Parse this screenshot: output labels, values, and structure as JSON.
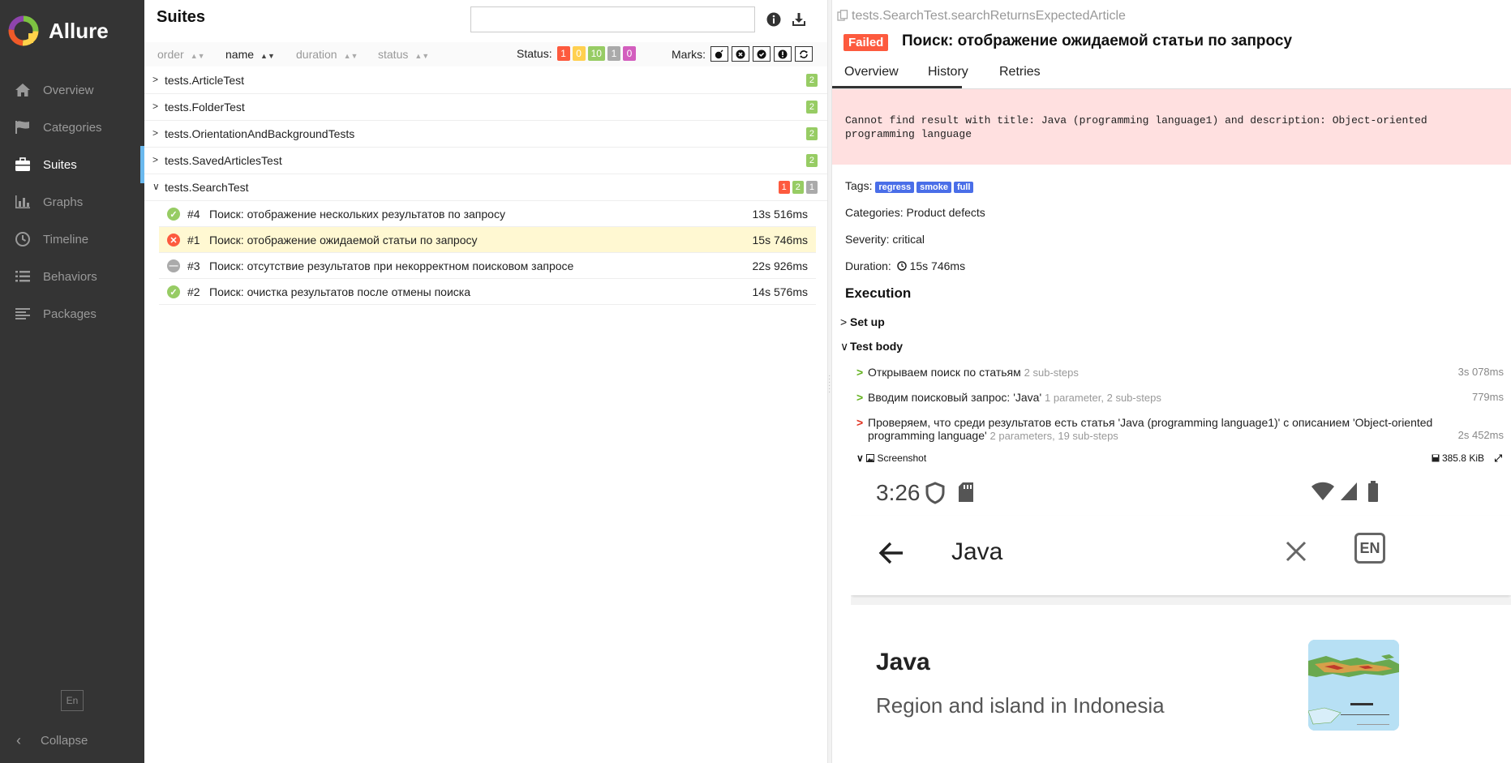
{
  "brand": {
    "name": "Allure"
  },
  "sidebar": {
    "items": [
      {
        "label": "Overview",
        "icon": "home-icon"
      },
      {
        "label": "Categories",
        "icon": "flag-icon"
      },
      {
        "label": "Suites",
        "icon": "briefcase-icon",
        "active": true
      },
      {
        "label": "Graphs",
        "icon": "bar-chart-icon"
      },
      {
        "label": "Timeline",
        "icon": "clock-icon"
      },
      {
        "label": "Behaviors",
        "icon": "list-icon"
      },
      {
        "label": "Packages",
        "icon": "align-left-icon"
      }
    ],
    "lang": "En",
    "collapse": "Collapse"
  },
  "suites": {
    "title": "Suites",
    "search_value": "",
    "sort": {
      "order": "order",
      "name": "name",
      "duration": "duration",
      "status": "status"
    },
    "status_label": "Status:",
    "status_counts": {
      "failed": "1",
      "broken": "0",
      "passed": "10",
      "skipped": "1",
      "unknown": "0"
    },
    "marks_label": "Marks:",
    "groups": [
      {
        "name": "tests.ArticleTest",
        "passed": "2"
      },
      {
        "name": "tests.FolderTest",
        "passed": "2"
      },
      {
        "name": "tests.OrientationAndBackgroundTests",
        "passed": "2"
      },
      {
        "name": "tests.SavedArticlesTest",
        "passed": "2"
      }
    ],
    "open_group": {
      "name": "tests.SearchTest",
      "failed": "1",
      "passed": "2",
      "skipped": "1"
    },
    "tests": [
      {
        "num": "#4",
        "name": "Поиск: отображение нескольких результатов по запросу",
        "duration": "13s 516ms",
        "status": "passed"
      },
      {
        "num": "#1",
        "name": "Поиск: отображение ожидаемой статьи по запросу",
        "duration": "15s 746ms",
        "status": "failed"
      },
      {
        "num": "#3",
        "name": "Поиск: отсутствие результатов при некорректном поисковом запросе",
        "duration": "22s 926ms",
        "status": "skipped"
      },
      {
        "num": "#2",
        "name": "Поиск: очистка результатов после отмены поиска",
        "duration": "14s 576ms",
        "status": "passed"
      }
    ]
  },
  "detail": {
    "breadcrumb": "tests.SearchTest.searchReturnsExpectedArticle",
    "status": "Failed",
    "title": "Поиск: отображение ожидаемой статьи по запросу",
    "tabs": [
      "Overview",
      "History",
      "Retries"
    ],
    "error": "Cannot find result with title: Java (programming language1) and description: Object-oriented programming language",
    "tags_label": "Tags:",
    "tags": [
      "regress",
      "smoke",
      "full"
    ],
    "categories": "Categories: Product defects",
    "severity": "Severity: critical",
    "duration_label": "Duration:",
    "duration": "15s 746ms",
    "execution": "Execution",
    "setup": "Set up",
    "test_body": "Test body",
    "steps": [
      {
        "text": "Открываем поиск по статьям",
        "sub": "2 sub-steps",
        "duration": "3s 078ms",
        "status": "passed"
      },
      {
        "text": "Вводим поисковый запрос: 'Java'",
        "sub": "1 parameter, 2 sub-steps",
        "duration": "779ms",
        "status": "passed"
      },
      {
        "text": "Проверяем, что среди результатов есть статья 'Java (programming language1)' с описанием 'Object-oriented programming language'",
        "sub": "2 parameters, 19 sub-steps",
        "duration": "2s 452ms",
        "status": "failed"
      }
    ],
    "attachment": {
      "name": "Screenshot",
      "size": "385.8 KiB"
    }
  },
  "phone": {
    "time": "3:26",
    "query": "Java",
    "lang": "EN",
    "result_title": "Java",
    "result_desc": "Region and island in Indonesia"
  },
  "colors": {
    "failed": "#fd5a3e",
    "broken": "#ffd050",
    "passed": "#97cc64",
    "skipped": "#aaaaaa",
    "unknown": "#d35ebe",
    "sidebar_bg": "#343434",
    "accent": "#6bb9ee",
    "error_bg": "#ffe0e0",
    "selected_row": "#fff8d2",
    "tag": "#4a6ee8"
  }
}
